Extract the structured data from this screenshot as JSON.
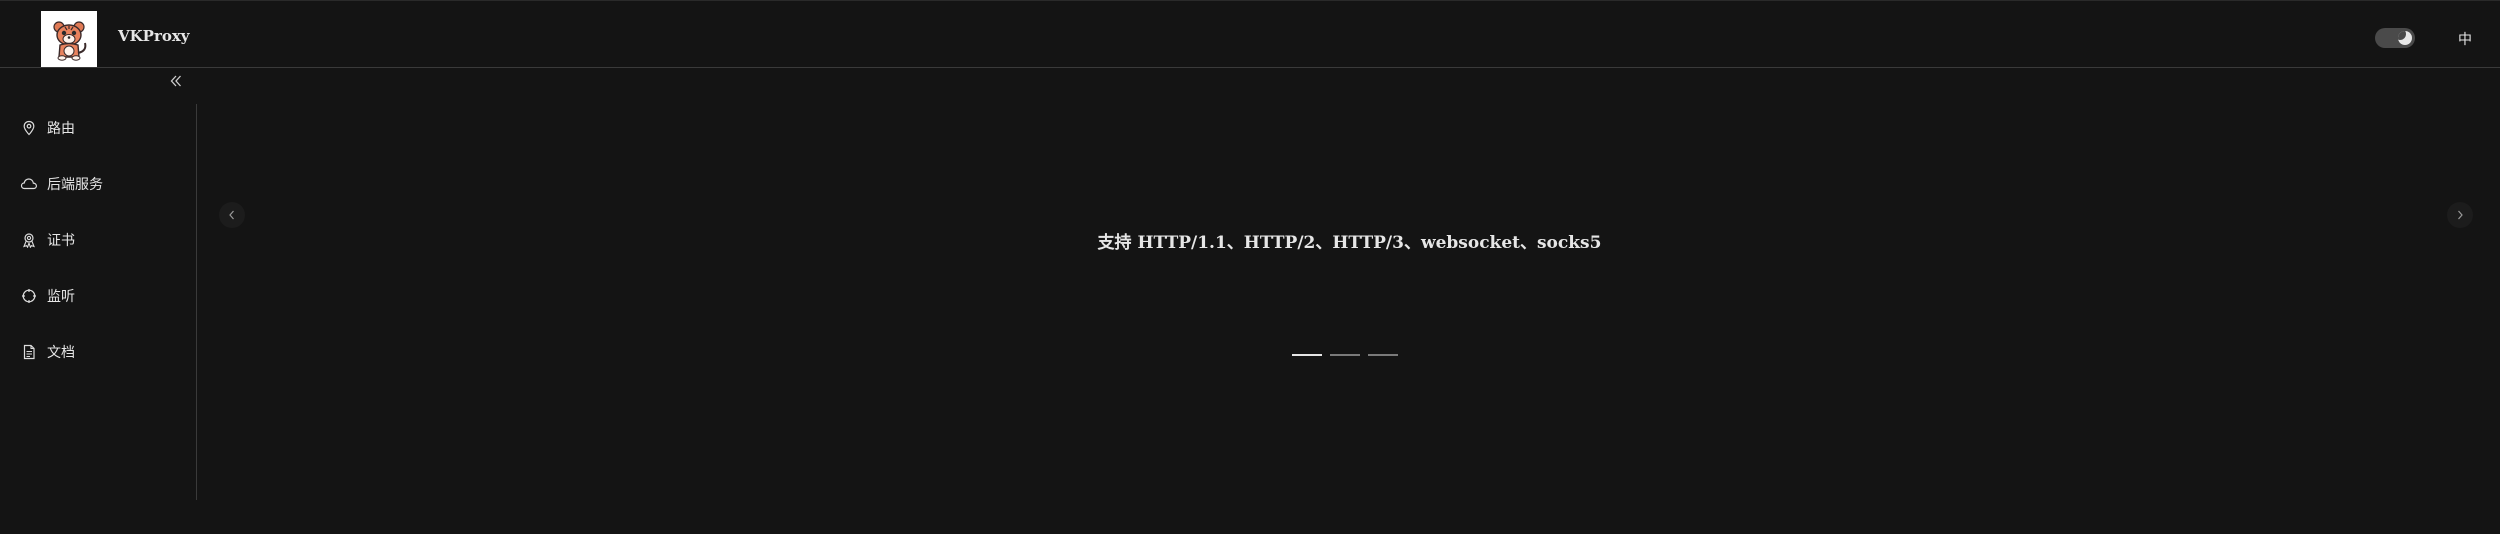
{
  "header": {
    "brand": "VKProxy",
    "lang_label": "中"
  },
  "sidebar": {
    "items": [
      {
        "label": "路由",
        "icon": "location-pin-icon"
      },
      {
        "label": "后端服务",
        "icon": "cloud-icon"
      },
      {
        "label": "证书",
        "icon": "certificate-icon"
      },
      {
        "label": "监听",
        "icon": "crosshair-icon"
      },
      {
        "label": "文档",
        "icon": "document-icon"
      }
    ]
  },
  "carousel": {
    "slide_text": "支持 HTTP/1.1、HTTP/2、HTTP/3、websocket、socks5",
    "slide_count": 3,
    "active_index": 0
  },
  "colors": {
    "background": "#141414",
    "text": "#e6e6e6",
    "divider": "#3a3a3a"
  }
}
